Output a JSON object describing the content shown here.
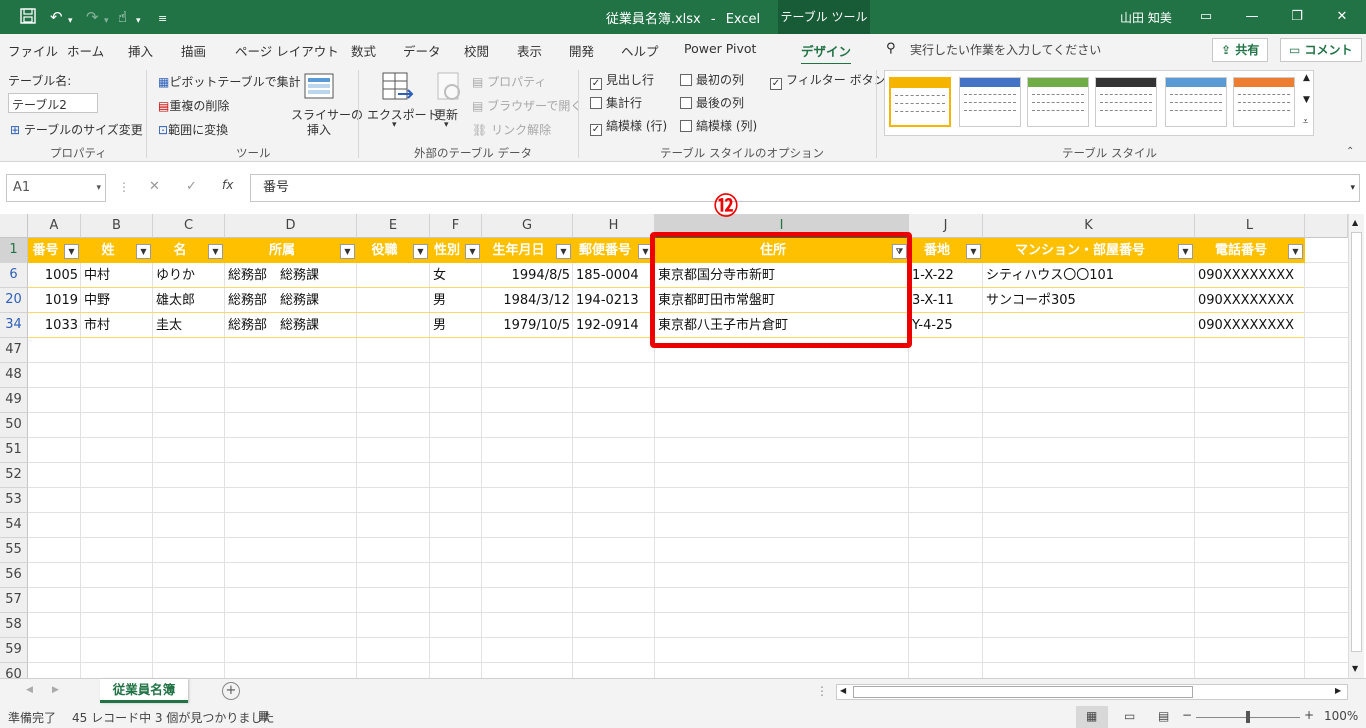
{
  "titlebar": {
    "filename": "従業員名簿.xlsx",
    "separator": "-",
    "app": "Excel",
    "contextual_tab": "テーブル ツール",
    "user": "山田 知美"
  },
  "ribbon_tabs": [
    "ファイル",
    "ホーム",
    "挿入",
    "描画",
    "ページ レイアウト",
    "数式",
    "データ",
    "校閲",
    "表示",
    "開発",
    "ヘルプ",
    "Power Pivot",
    "デザイン"
  ],
  "tell_me": "実行したい作業を入力してください",
  "share_label": "共有",
  "comment_label": "コメント",
  "properties": {
    "table_name_label": "テーブル名:",
    "table_name_value": "テーブル2",
    "resize_label": "テーブルのサイズ変更",
    "group_label": "プロパティ"
  },
  "tools": {
    "pivot_label": "ピボットテーブルで集計",
    "remove_dup_label": "重複の削除",
    "convert_label": "範囲に変換",
    "slicer_label_1": "スライサーの",
    "slicer_label_2": "挿入",
    "group_label": "ツール"
  },
  "external": {
    "export_label": "エクスポート",
    "refresh_label": "更新",
    "properties_label": "プロパティ",
    "browser_label": "ブラウザーで開く",
    "unlink_label": "リンク解除",
    "group_label": "外部のテーブル データ"
  },
  "style_options": {
    "header_row": {
      "label": "見出し行",
      "checked": "✓"
    },
    "total_row": {
      "label": "集計行",
      "checked": ""
    },
    "banded_rows": {
      "label": "縞模様 (行)",
      "checked": "✓"
    },
    "first_col": {
      "label": "最初の列",
      "checked": ""
    },
    "last_col": {
      "label": "最後の列",
      "checked": ""
    },
    "banded_cols": {
      "label": "縞模様 (列)",
      "checked": ""
    },
    "filter_button": {
      "label": "フィルター ボタン",
      "checked": "✓"
    },
    "group_label": "テーブル スタイルのオプション"
  },
  "table_styles": {
    "group_label": "テーブル スタイル",
    "swatch_colors": [
      "#f5b400",
      "#4472c4",
      "#70ad47",
      "#333333",
      "#5b9bd5",
      "#ed7d31"
    ]
  },
  "formula_bar": {
    "name_box": "A1",
    "cancel": "✕",
    "enter": "✓",
    "fx": "fx",
    "content": "番号"
  },
  "sheet": {
    "columns": [
      "A",
      "B",
      "C",
      "D",
      "E",
      "F",
      "G",
      "H",
      "I",
      "J",
      "K",
      "L"
    ],
    "selected_column": "I",
    "header_row_number": "1",
    "headers": [
      "番号",
      "姓",
      "名",
      "所属",
      "役職",
      "性別",
      "生年月日",
      "郵便番号",
      "住所",
      "番地",
      "マンション・部屋番号",
      "電話番号"
    ],
    "rows": [
      {
        "num": "6",
        "cells": [
          "1005",
          "中村",
          "ゆりか",
          "総務部　総務課",
          "",
          "女",
          "1994/8/5",
          "185-0004",
          "東京都国分寺市新町",
          "1-X-22",
          "シティハウス〇〇101",
          "090XXXXXXXX"
        ]
      },
      {
        "num": "20",
        "cells": [
          "1019",
          "中野",
          "雄太郎",
          "総務部　総務課",
          "",
          "男",
          "1984/3/12",
          "194-0213",
          "東京都町田市常盤町",
          "3-X-11",
          "サンコーポ305",
          "090XXXXXXXX"
        ]
      },
      {
        "num": "34",
        "cells": [
          "1033",
          "市村",
          "圭太",
          "総務部　総務課",
          "",
          "男",
          "1979/10/5",
          "192-0914",
          "東京都八王子市片倉町",
          "Y-4-25",
          "",
          "090XXXXXXXX"
        ]
      }
    ],
    "empty_rows": [
      "47",
      "48",
      "49",
      "50",
      "51",
      "52",
      "53",
      "54",
      "55",
      "56",
      "57",
      "58",
      "59",
      "60"
    ],
    "annotation_marker": "⑫"
  },
  "sheet_tabs": {
    "active": "従業員名簿",
    "add": "+"
  },
  "status": {
    "ready": "準備完了",
    "filter_message": "45 レコード中 3 個が見つかりました",
    "zoom": "100%",
    "zoom_level": 1.0
  },
  "colors": {
    "excel_green": "#217346",
    "table_header": "#ffc000",
    "highlight": "#ee0000"
  }
}
